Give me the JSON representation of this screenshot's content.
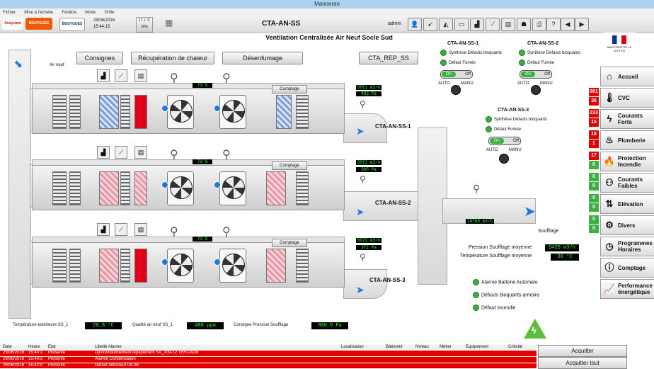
{
  "window": {
    "title": "Manoeran"
  },
  "menu": [
    "Fichier",
    "Mise à l'échelle",
    "Fenêtre",
    "Mode",
    "Grille"
  ],
  "toolbar": {
    "logo1": "Assystem",
    "logo2": "BOUYGUES",
    "logo3": "BOUYGUES",
    "date": "29/06/2016",
    "time": "15:44:15",
    "weather_temp": "27.1 °C",
    "weather_hum": "39%",
    "system_name": "CTA-AN-SS",
    "user": "admin"
  },
  "page_title": "Ventilation Centralisée Air Neuf Socle Sud",
  "top_buttons": [
    "Consignes",
    "Récupération de chaleur",
    "Désenfumage",
    "CTA_REP_SS"
  ],
  "air_neuf_label": "Air neuf",
  "comptage_label": "Comptage",
  "units": [
    {
      "name": "CTA-AN-SS-1",
      "valve": "73 %",
      "flow": "5051 m3/h",
      "pressure": "495 Pa"
    },
    {
      "name": "CTA-AN-SS-2",
      "valve": "73 %",
      "flow": "5072 m3/h",
      "pressure": "505 Pa"
    },
    {
      "name": "CTA-AN-SS-3",
      "valve": "73 %",
      "flow": "5072 m3/h",
      "pressure": "372 Pa"
    }
  ],
  "status_panels": [
    {
      "title": "CTA-AN-SS-1",
      "line1": "Synthèse Défauts bloquants",
      "line2": "Défaut Fumée",
      "on": "On",
      "off": "Off",
      "auto": "AUTO",
      "manu": "MANU"
    },
    {
      "title": "CTA-AN-SS-2",
      "line1": "Synthèse Défauts bloquants",
      "line2": "Défaut Fumée",
      "on": "On",
      "off": "Off",
      "auto": "AUTO",
      "manu": "MANU"
    },
    {
      "title": "CTA-AN-SS-3",
      "line1": "Synthèse Défauts bloquants",
      "line2": "Défaut Fumée",
      "on": "On",
      "off": "Off",
      "auto": "AUTO",
      "manu": "MANU"
    }
  ],
  "soufflage": {
    "label": "Soufflage",
    "flow": "16769 m3/h",
    "pressure_label": "Pression Soufflage moyenne",
    "pressure": "5425 m3/h",
    "temp_label": "Température Soufflage moyenne",
    "temp": "30 °C"
  },
  "alarms_summary": [
    "Alarme Batterie Automate",
    "Défauts bloquants armoire",
    "Défaut incendie"
  ],
  "bottom": {
    "ext_temp_label": "Température extérieure SS_1",
    "ext_temp": "28,8 °C",
    "air_quality_label": "Qualité air neuf SS_1",
    "air_quality": "488 ppm",
    "pressure_cons_label": "Consigne Pression Soufflage",
    "pressure_cons": "800,0 Pa"
  },
  "nav": [
    {
      "label": "Accueil",
      "icon": "house-icon",
      "glyph": "⌂",
      "count_top": "",
      "count_bot": ""
    },
    {
      "label": "CVC",
      "icon": "thermometer-icon",
      "glyph": "🌡",
      "count_top": "881",
      "count_bot": "35"
    },
    {
      "label": "Courants Forts",
      "icon": "lightning-icon",
      "glyph": "ϟ",
      "count_top": "233",
      "count_bot": "15"
    },
    {
      "label": "Plomberie",
      "icon": "faucet-icon",
      "glyph": "♨",
      "count_top": "16",
      "count_bot": "1"
    },
    {
      "label": "Protection Incendie",
      "icon": "fire-icon",
      "glyph": "🔥",
      "count_top": "17",
      "count_bot": "0"
    },
    {
      "label": "Courants Faibles",
      "icon": "socket-icon",
      "glyph": "⚇",
      "count_top": "0",
      "count_bot": "0"
    },
    {
      "label": "Elévation",
      "icon": "elevator-icon",
      "glyph": "⇅",
      "count_top": "0",
      "count_bot": "0"
    },
    {
      "label": "Divers",
      "icon": "gears-icon",
      "glyph": "⚙",
      "count_top": "0",
      "count_bot": "0"
    },
    {
      "label": "Programmes Horaires",
      "icon": "clock-icon",
      "glyph": "◷",
      "count_top": "",
      "count_bot": ""
    },
    {
      "label": "Comptage",
      "icon": "info-icon",
      "glyph": "ⓘ",
      "count_top": "",
      "count_bot": ""
    },
    {
      "label": "Performance énergétique",
      "icon": "chart-icon",
      "glyph": "📈",
      "count_top": "",
      "count_bot": ""
    }
  ],
  "ministry_label": "MINISTÈRE DE LA JUSTICE",
  "alarm_table": {
    "headers": [
      "Date",
      "Heure",
      "Etat",
      "Libellé Alarme",
      "Localisation",
      "Bâtiment",
      "Niveau",
      "Métier",
      "Equipement",
      "Criticité"
    ],
    "rows": [
      [
        "29/06/2016",
        "15:40:1",
        "Présente",
        "Dysfonctionnement équipement SA_209-12 TERCADB",
        "",
        "",
        "",
        "",
        "",
        ""
      ],
      [
        "29/06/2016",
        "15:40:3",
        "Présente",
        "Alarme Condensation",
        "",
        "",
        "",
        "",
        "",
        ""
      ],
      [
        "29/06/2016",
        "15:42:0",
        "Présente",
        "Défaut détecteur 04-3B",
        "",
        "",
        "",
        "",
        "",
        ""
      ]
    ]
  },
  "ack_buttons": [
    "Acquitter",
    "Acquitter tout"
  ],
  "colors": {
    "accent_blue": "#1f7ae0",
    "alarm_red": "#e00000",
    "lcd_green": "#33ff33",
    "ok_green": "#3cb043"
  }
}
